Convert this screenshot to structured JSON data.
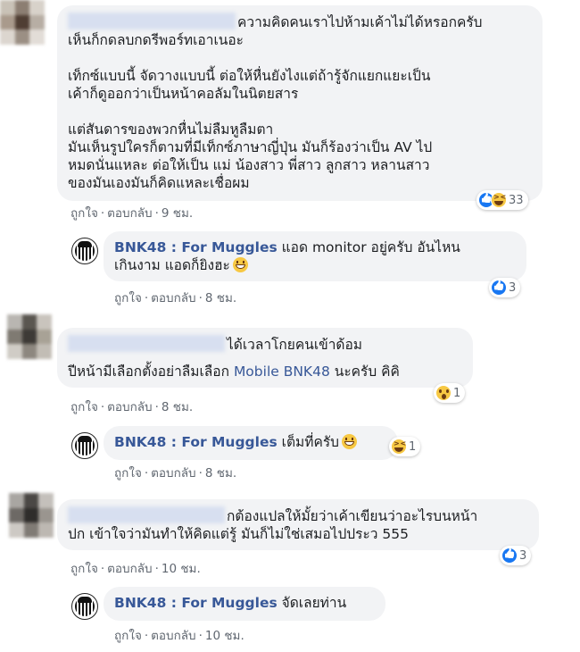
{
  "page_name": "BNK48 : For Muggles",
  "actions": {
    "like": "ถูกใจ",
    "reply": "ตอบกลับ",
    "separator": "·"
  },
  "colors": {
    "bubble_bg": "#f2f3f5",
    "link": "#385898",
    "meta": "#606770",
    "like_blue": "#1877f2",
    "emoji_yellow": "#f7c843"
  },
  "comments": [
    {
      "paragraphs": [
        "ความคิดคนเราไปห้ามเค้าไม่ได้หรอกครับ\nเห็นก็กดลบกดรีพอร์ทเอาเนอะ",
        "เท็กซ์แบบนี้ จัดวางแบบนี้ ต่อให้หื่นยังไงแต่ถ้ารู้จักแยกแยะเป็น\nเค้าก็ดูออกว่าเป็นหน้าคอลัมในนิตยสาร",
        "แต่สันดารของพวกหื่นไม่ลืมหูลืมตา\nมันเห็นรูปใครก็ตามที่มีเท็กซ์ภาษาญี่ปุ่น มันก็ร้องว่าเป็น AV ไป\nหมดนั่นแหละ ต่อให้เป็น แม่ น้องสาว พี่สาว ลูกสาว หลานสาว\nของมันเองมันก็คิดแหละเชื่อผม"
      ],
      "time": "9 ชม.",
      "reaction_icons": [
        "like-icon",
        "haha-icon"
      ],
      "reaction_count": "33"
    },
    {
      "text_after_name": "แอด monitor อยู่ครับ อันไหน\nเกินงาม แอดก็ยิงฮะ",
      "emoji": "grinning-icon",
      "time": "8 ชม.",
      "reaction_icons": [
        "like-icon"
      ],
      "reaction_count": "3"
    },
    {
      "line1": "ได้เวลาโกยคนเข้าด้อม",
      "line2_before": "ปีหน้ามีเลือกตั้งอย่าลืมเลือก",
      "line2_link": "Mobile BNK48",
      "line2_after": "นะครับ คิคิ",
      "time": "8 ชม.",
      "reaction_icons": [
        "wow-icon"
      ],
      "reaction_count": "1"
    },
    {
      "text_after_name": "เต็มที่ครับ",
      "emoji": "grinning-icon",
      "time": "8 ชม.",
      "reaction_icons": [
        "haha-icon"
      ],
      "reaction_count": "1"
    },
    {
      "text": "กต้องแปลให้มั้ยว่าเค้าเขียนว่าอะไรบนหน้า\nปก เข้าใจว่ามันทำให้คิดแต่รู้ มันก็ไม่ใช่เสมอไปประว 555",
      "time": "10 ชม.",
      "reaction_icons": [
        "like-icon"
      ],
      "reaction_count": "3"
    },
    {
      "text_after_name": "จัดเลยท่าน",
      "time": "10 ชม."
    }
  ]
}
